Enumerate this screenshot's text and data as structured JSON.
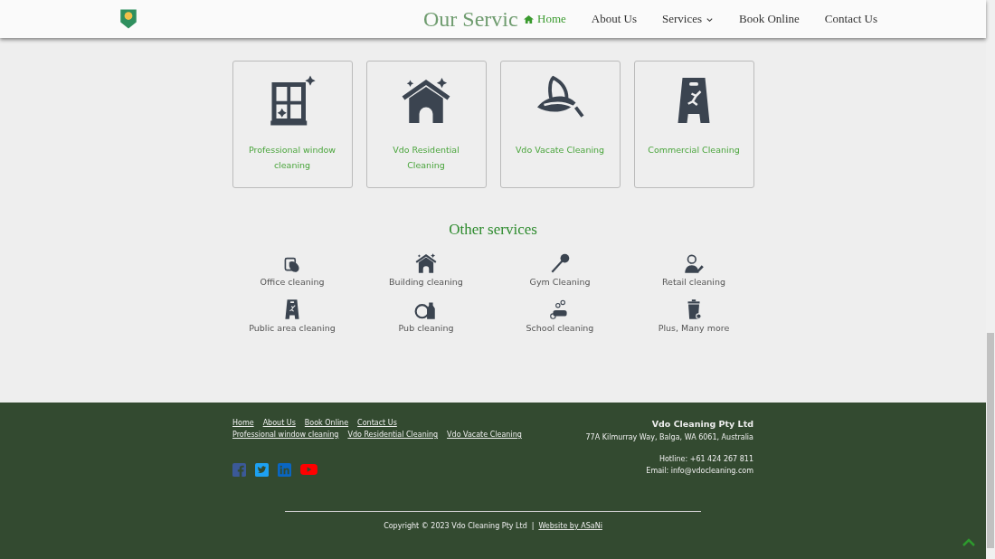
{
  "header": {
    "nav": [
      {
        "label": "Home",
        "selected": true,
        "dropdown": false
      },
      {
        "label": "About Us",
        "selected": false,
        "dropdown": false
      },
      {
        "label": "Services",
        "selected": false,
        "dropdown": true
      },
      {
        "label": "Book Online",
        "selected": false,
        "dropdown": false
      },
      {
        "label": "Contact Us",
        "selected": false,
        "dropdown": false
      }
    ]
  },
  "section_title": "Our Servic",
  "main_services": [
    {
      "kind": "window",
      "label": "Professional window cleaning"
    },
    {
      "kind": "house",
      "label": "Vdo Residential Cleaning"
    },
    {
      "kind": "leaf",
      "label": "Vdo Vacate Cleaning"
    },
    {
      "kind": "sign",
      "label": "Commercial Cleaning"
    }
  ],
  "other_title": "Other services",
  "other_services": [
    {
      "kind": "hand",
      "label": "Office cleaning"
    },
    {
      "kind": "house",
      "label": "Building cleaning"
    },
    {
      "kind": "brush",
      "label": "Gym Cleaning"
    },
    {
      "kind": "person",
      "label": "Retail cleaning"
    },
    {
      "kind": "sign",
      "label": "Public area cleaning"
    },
    {
      "kind": "dish",
      "label": "Pub cleaning"
    },
    {
      "kind": "soap",
      "label": "School cleaning"
    },
    {
      "kind": "bin",
      "label": "Plus, Many more"
    }
  ],
  "footer": {
    "links_row_1": [
      "Home",
      "About Us",
      "Book Online",
      "Contact Us"
    ],
    "links_row_2": [
      "Professional window cleaning",
      "Vdo Residential Cleaning",
      "Vdo Vacate Cleaning"
    ],
    "social": [
      {
        "kind": "facebook",
        "color": "#3b5998"
      },
      {
        "kind": "twitter",
        "color": "#1da1f2"
      },
      {
        "kind": "linkedin",
        "color": "#0a66c2"
      },
      {
        "kind": "youtube",
        "color": "#ff0000"
      }
    ],
    "company": "Vdo Cleaning Pty Ltd",
    "address": "77A Kilmurray Way, Balga, WA 6061, Australia",
    "hotline": "Hotline: +61 424 267 811",
    "email": "Email: info@vdocleaning.com",
    "copyright": "Copyright © 2023 Vdo Cleaning Pty Ltd",
    "separator": "|",
    "credit": "Website by ASaNi"
  }
}
